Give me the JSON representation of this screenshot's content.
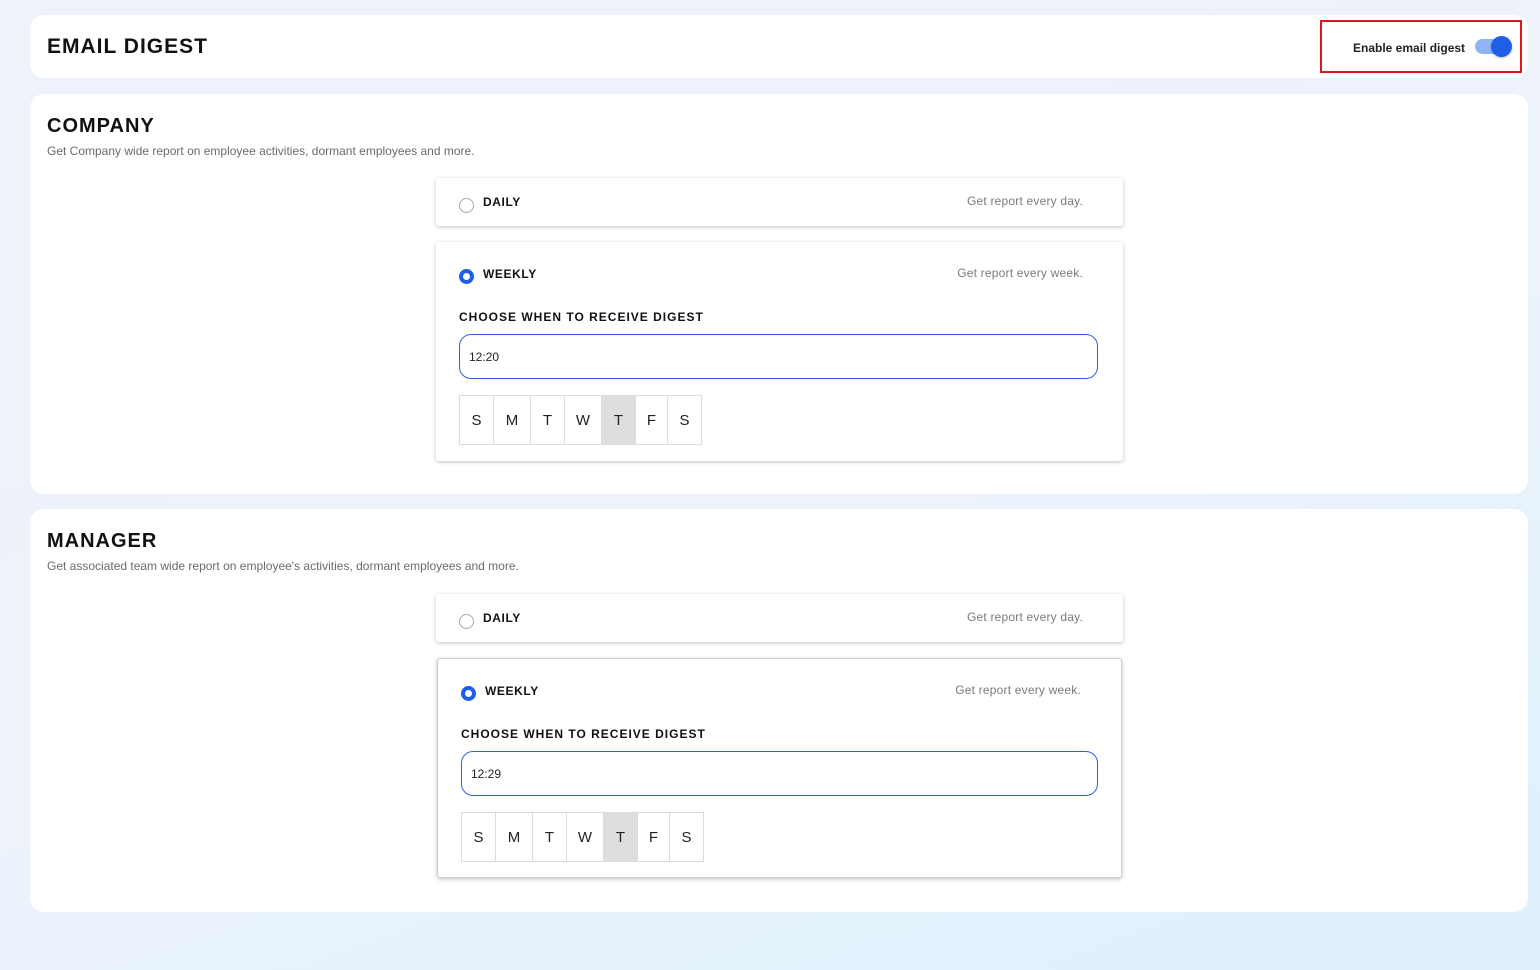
{
  "header": {
    "title": "EMAIL DIGEST",
    "toggle_label": "Enable email digest",
    "toggle_on": true
  },
  "colors": {
    "accent": "#1f5fe8",
    "highlight_border": "#e0141e",
    "selected_day_bg": "#dedede"
  },
  "sections": [
    {
      "title": "COMPANY",
      "description": "Get Company wide report on employee activities, dormant employees and more.",
      "daily": {
        "label": "DAILY",
        "description": "Get report every day.",
        "checked": false
      },
      "weekly": {
        "label": "WEEKLY",
        "description": "Get report every week.",
        "checked": true,
        "choose_label": "CHOOSE WHEN TO RECEIVE DIGEST",
        "time_value": "12:20",
        "days": [
          "S",
          "M",
          "T",
          "W",
          "T",
          "F",
          "S"
        ],
        "selected_day_index": 4
      }
    },
    {
      "title": "MANAGER",
      "description": "Get associated team wide report on employee's activities, dormant employees and more.",
      "daily": {
        "label": "DAILY",
        "description": "Get report every day.",
        "checked": false
      },
      "weekly": {
        "label": "WEEKLY",
        "description": "Get report every week.",
        "checked": true,
        "choose_label": "CHOOSE WHEN TO RECEIVE DIGEST",
        "time_value": "12:29",
        "days": [
          "S",
          "M",
          "T",
          "W",
          "T",
          "F",
          "S"
        ],
        "selected_day_index": 4
      }
    }
  ]
}
